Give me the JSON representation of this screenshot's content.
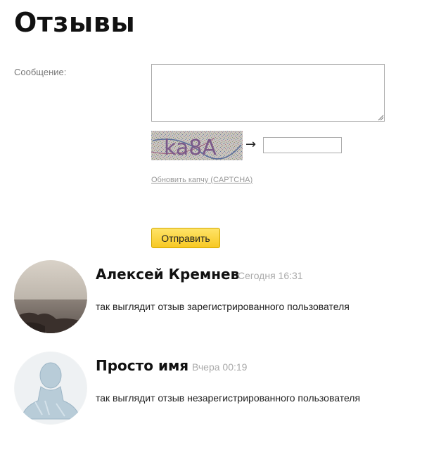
{
  "page": {
    "title": "Отзывы"
  },
  "form": {
    "message_label": "Сообщение:",
    "message_value": "",
    "captcha_text": "ka8A",
    "captcha_arrow": "→",
    "captcha_value": "",
    "refresh_link": "Обновить капчу (CAPTCHA)",
    "submit_label": "Отправить"
  },
  "reviews": [
    {
      "author": "Алексей Кремнев",
      "time": "Сегодня 16:31",
      "text": "так выглядит отзыв зарегистрированного пользователя",
      "avatar_icon": "seascape-photo-avatar"
    },
    {
      "author": "Просто имя",
      "time": "Вчера 00:19",
      "text": "так выглядит отзыв незарегистрированного пользователя",
      "avatar_icon": "default-user-avatar"
    }
  ],
  "colors": {
    "button_top": "#ffe468",
    "button_bottom": "#f7c823",
    "muted_text": "#aaaaaa"
  }
}
